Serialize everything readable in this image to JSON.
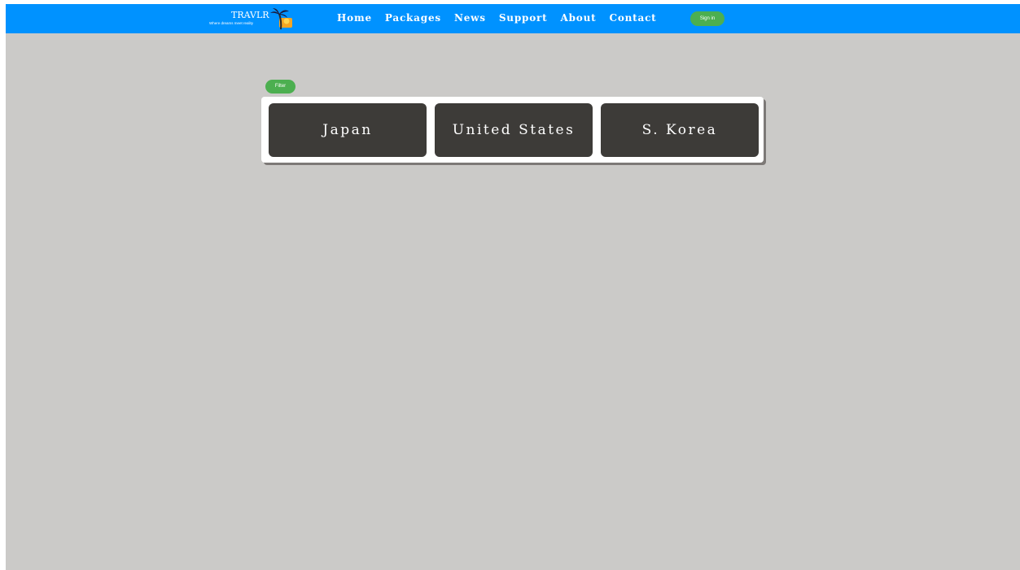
{
  "navbar": {
    "logo_text": "TRAVLR",
    "logo_tagline": "Where dreams meet reality",
    "links": [
      "Home",
      "Packages",
      "News",
      "Support",
      "About",
      "Contact"
    ],
    "signin_label": "Sign in",
    "bg_color": "#0092ff"
  },
  "main": {
    "filter_label": "Filter",
    "countries": [
      "Japan",
      "United States",
      "S. Korea"
    ],
    "bg_color": "#cbcac8",
    "card_color": "#3d3b38",
    "button_color": "#4caf50"
  }
}
